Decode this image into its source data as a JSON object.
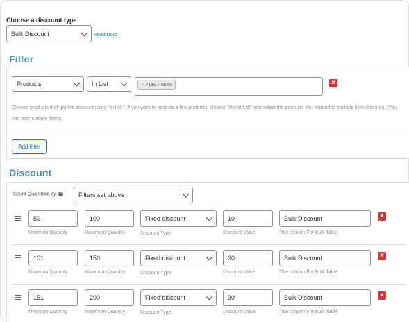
{
  "discount_type": {
    "label": "Choose a discount type",
    "selected": "Bulk Discount",
    "read_docs": "Read Docs"
  },
  "filter": {
    "heading": "Filter",
    "field": "Products",
    "condition": "In List",
    "tag": "#185 T-Shirts",
    "tag_remove": "×",
    "help": "Choose products that get the discount using \"In List\". If you want to exclude a few products, choose \"Not In List\" and select the products you wanted to exclude from discount. (You can add multiple filters)",
    "add_filter": "Add filter"
  },
  "discount": {
    "heading": "Discount",
    "count_label": "Count Quantities by:",
    "count_help": "?",
    "count_selected": "Filters set above",
    "labels": {
      "min": "Minimum Quantity",
      "max": "Maximum Quantity",
      "type": "Discount Type",
      "value": "Discount Value",
      "title": "Title column For Bulk Table"
    },
    "rows": [
      {
        "min": "50",
        "max": "100",
        "type": "Fixed discount",
        "value": "10",
        "title": "Bulk Discount"
      },
      {
        "min": "101",
        "max": "150",
        "type": "Fixed discount",
        "value": "20",
        "title": "Bulk Discount"
      },
      {
        "min": "151",
        "max": "200",
        "type": "Fixed discount",
        "value": "30",
        "title": "Bulk Discount"
      }
    ]
  },
  "colors": {
    "accent": "#4b8ec6",
    "link": "#2271b1",
    "danger": "#d63638"
  }
}
